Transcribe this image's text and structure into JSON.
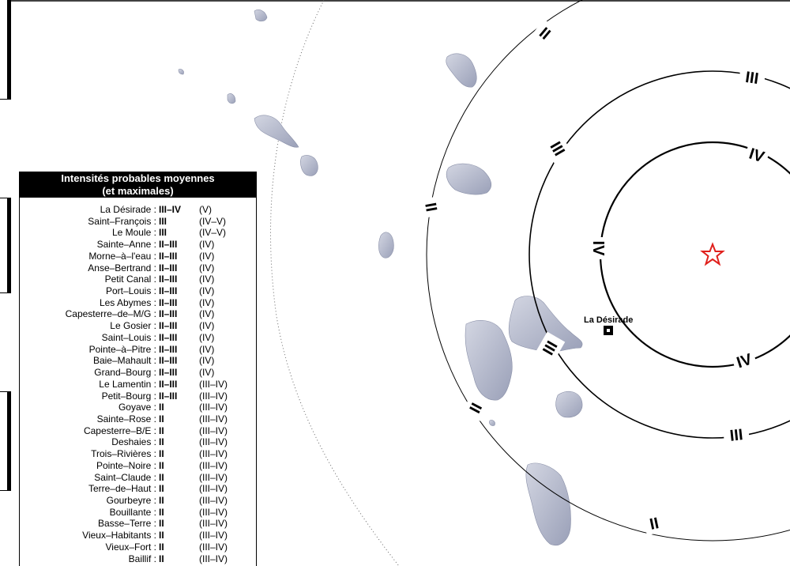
{
  "legend": {
    "title_line1": "Intensités probables moyennes",
    "title_line2": "(et maximales)",
    "rows": [
      {
        "name": "La Désirade :",
        "mean": "III–IV",
        "max": "(V)"
      },
      {
        "name": "Saint–François :",
        "mean": "III",
        "max": "(IV–V)"
      },
      {
        "name": "Le Moule :",
        "mean": "III",
        "max": "(IV–V)"
      },
      {
        "name": "Sainte–Anne :",
        "mean": "II–III",
        "max": "(IV)"
      },
      {
        "name": "Morne–à–l'eau :",
        "mean": "II–III",
        "max": "(IV)"
      },
      {
        "name": "Anse–Bertrand :",
        "mean": "II–III",
        "max": "(IV)"
      },
      {
        "name": "Petit Canal :",
        "mean": "II–III",
        "max": "(IV)"
      },
      {
        "name": "Port–Louis :",
        "mean": "II–III",
        "max": "(IV)"
      },
      {
        "name": "Les Abymes :",
        "mean": "II–III",
        "max": "(IV)"
      },
      {
        "name": "Capesterre–de–M/G :",
        "mean": "II–III",
        "max": "(IV)"
      },
      {
        "name": "Le Gosier :",
        "mean": "II–III",
        "max": "(IV)"
      },
      {
        "name": "Saint–Louis :",
        "mean": "II–III",
        "max": "(IV)"
      },
      {
        "name": "Pointe–à–Pitre :",
        "mean": "II–III",
        "max": "(IV)"
      },
      {
        "name": "Baie–Mahault :",
        "mean": "II–III",
        "max": "(IV)"
      },
      {
        "name": "Grand–Bourg :",
        "mean": "II–III",
        "max": "(IV)"
      },
      {
        "name": "Le Lamentin :",
        "mean": "II–III",
        "max": "(III–IV)"
      },
      {
        "name": "Petit–Bourg :",
        "mean": "II–III",
        "max": "(III–IV)"
      },
      {
        "name": "Goyave :",
        "mean": "II",
        "max": "(III–IV)"
      },
      {
        "name": "Sainte–Rose :",
        "mean": "II",
        "max": "(III–IV)"
      },
      {
        "name": "Capesterre–B/E :",
        "mean": "II",
        "max": "(III–IV)"
      },
      {
        "name": "Deshaies :",
        "mean": "II",
        "max": "(III–IV)"
      },
      {
        "name": "Trois–Rivières :",
        "mean": "II",
        "max": "(III–IV)"
      },
      {
        "name": "Pointe–Noire :",
        "mean": "II",
        "max": "(III–IV)"
      },
      {
        "name": "Saint–Claude :",
        "mean": "II",
        "max": "(III–IV)"
      },
      {
        "name": "Terre–de–Haut :",
        "mean": "II",
        "max": "(III–IV)"
      },
      {
        "name": "Gourbeyre :",
        "mean": "II",
        "max": "(III–IV)"
      },
      {
        "name": "Bouillante :",
        "mean": "II",
        "max": "(III–IV)"
      },
      {
        "name": "Basse–Terre :",
        "mean": "II",
        "max": "(III–IV)"
      },
      {
        "name": "Vieux–Habitants :",
        "mean": "II",
        "max": "(III–IV)"
      },
      {
        "name": "Vieux–Fort :",
        "mean": "II",
        "max": "(III–IV)"
      },
      {
        "name": "Baillif :",
        "mean": "II",
        "max": "(III–IV)"
      }
    ]
  },
  "map": {
    "place_label": "La Désirade",
    "epicenter_icon": "star-icon",
    "epicenter_color": "#e0201c",
    "land_color": "#b7bccf",
    "ring_labels": {
      "ring_iv": "IV",
      "ring_iii": "III",
      "ring_ii": "II"
    }
  }
}
